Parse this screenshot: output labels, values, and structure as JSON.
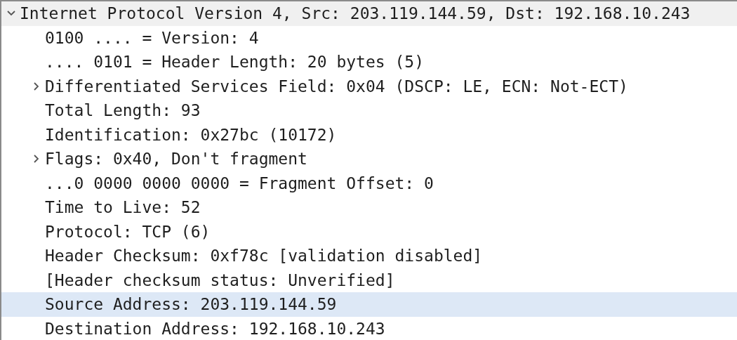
{
  "tree": [
    {
      "label": "Internet Protocol Version 4, Src: 203.119.144.59, Dst: 192.168.10.243",
      "expanded": true,
      "selected": false,
      "children": [
        {
          "label": "0100 .... = Version: 4",
          "selected": false
        },
        {
          "label": ".... 0101 = Header Length: 20 bytes (5)",
          "selected": false
        },
        {
          "label": "Differentiated Services Field: 0x04 (DSCP: LE, ECN: Not-ECT)",
          "expanded": false,
          "selected": false
        },
        {
          "label": "Total Length: 93",
          "selected": false
        },
        {
          "label": "Identification: 0x27bc (10172)",
          "selected": false
        },
        {
          "label": "Flags: 0x40, Don't fragment",
          "expanded": false,
          "selected": false
        },
        {
          "label": "...0 0000 0000 0000 = Fragment Offset: 0",
          "selected": false
        },
        {
          "label": "Time to Live: 52",
          "selected": false
        },
        {
          "label": "Protocol: TCP (6)",
          "selected": false
        },
        {
          "label": "Header Checksum: 0xf78c [validation disabled]",
          "selected": false
        },
        {
          "label": "[Header checksum status: Unverified]",
          "selected": false
        },
        {
          "label": "Source Address: 203.119.144.59",
          "selected": true
        },
        {
          "label": "Destination Address: 192.168.10.243",
          "selected": false
        }
      ]
    }
  ]
}
